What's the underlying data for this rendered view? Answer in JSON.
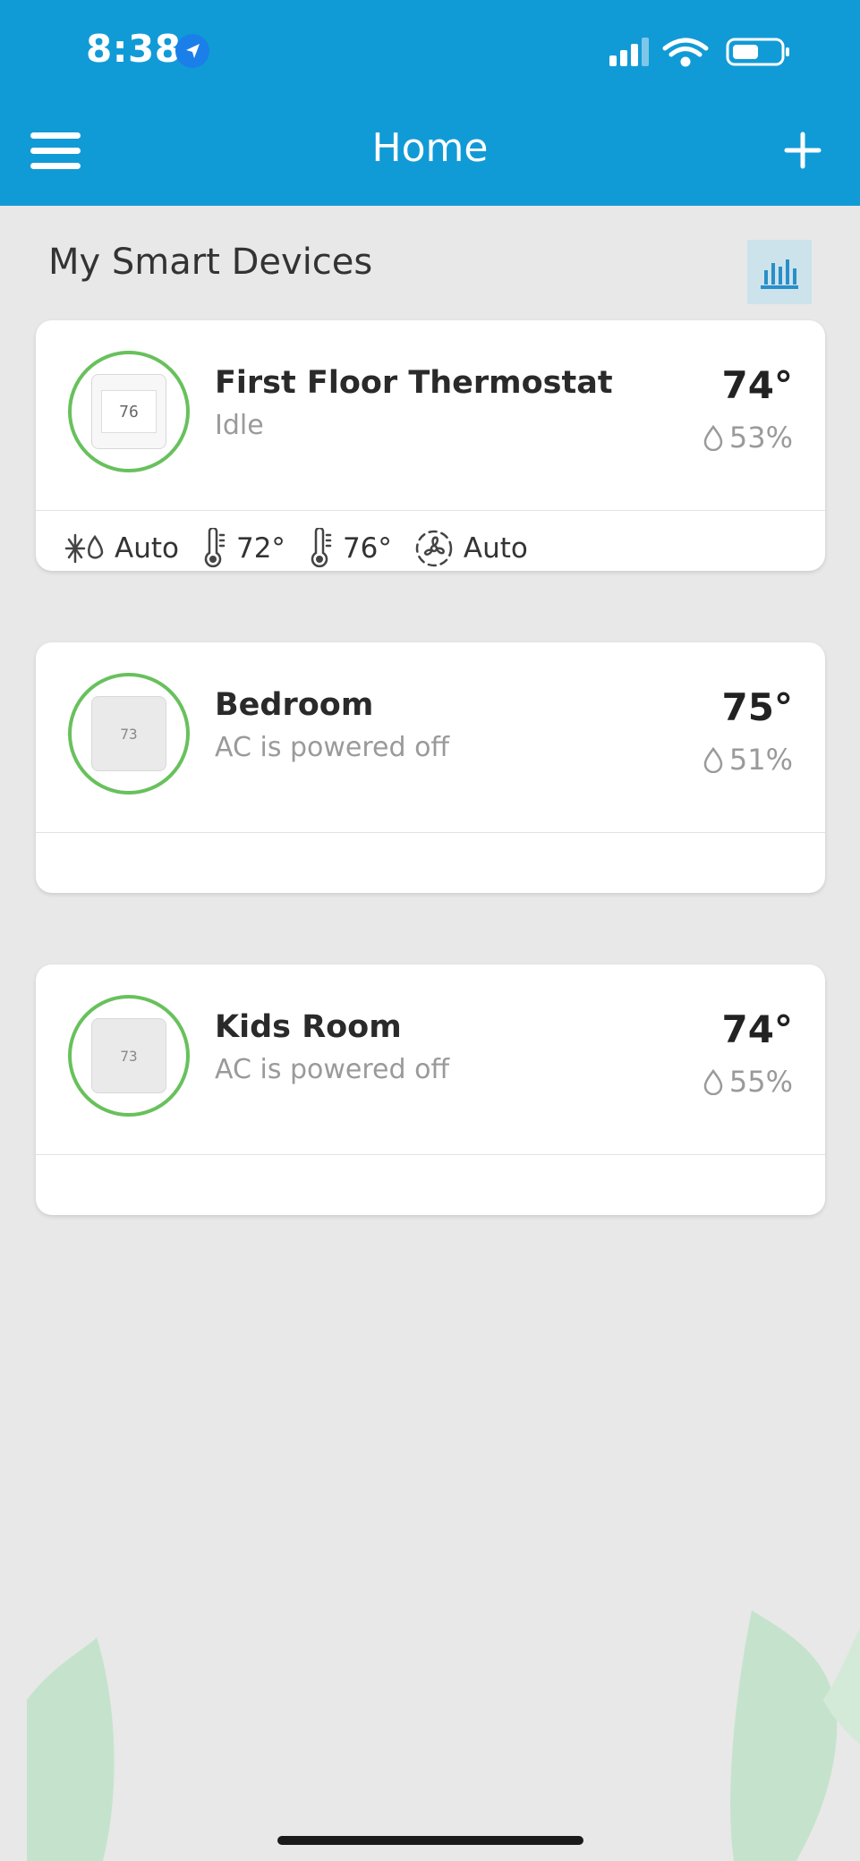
{
  "status_bar": {
    "time": "8:38"
  },
  "nav": {
    "title": "Home"
  },
  "section": {
    "title": "My Smart Devices"
  },
  "devices": [
    {
      "name": "First Floor Thermostat",
      "status": "Idle",
      "temperature": "74°",
      "humidity": "53%",
      "display_reading": "76",
      "controls": {
        "mode": "Auto",
        "setpoint_low": "72°",
        "setpoint_high": "76°",
        "fan": "Auto"
      }
    },
    {
      "name": "Bedroom",
      "status": "AC is powered off",
      "temperature": "75°",
      "humidity": "51%",
      "display_reading": "73"
    },
    {
      "name": "Kids Room",
      "status": "AC is powered off",
      "temperature": "74°",
      "humidity": "55%",
      "display_reading": "73"
    }
  ],
  "colors": {
    "header": "#119bd6",
    "accent_green": "#68c15c",
    "background": "#e8e8e8"
  }
}
